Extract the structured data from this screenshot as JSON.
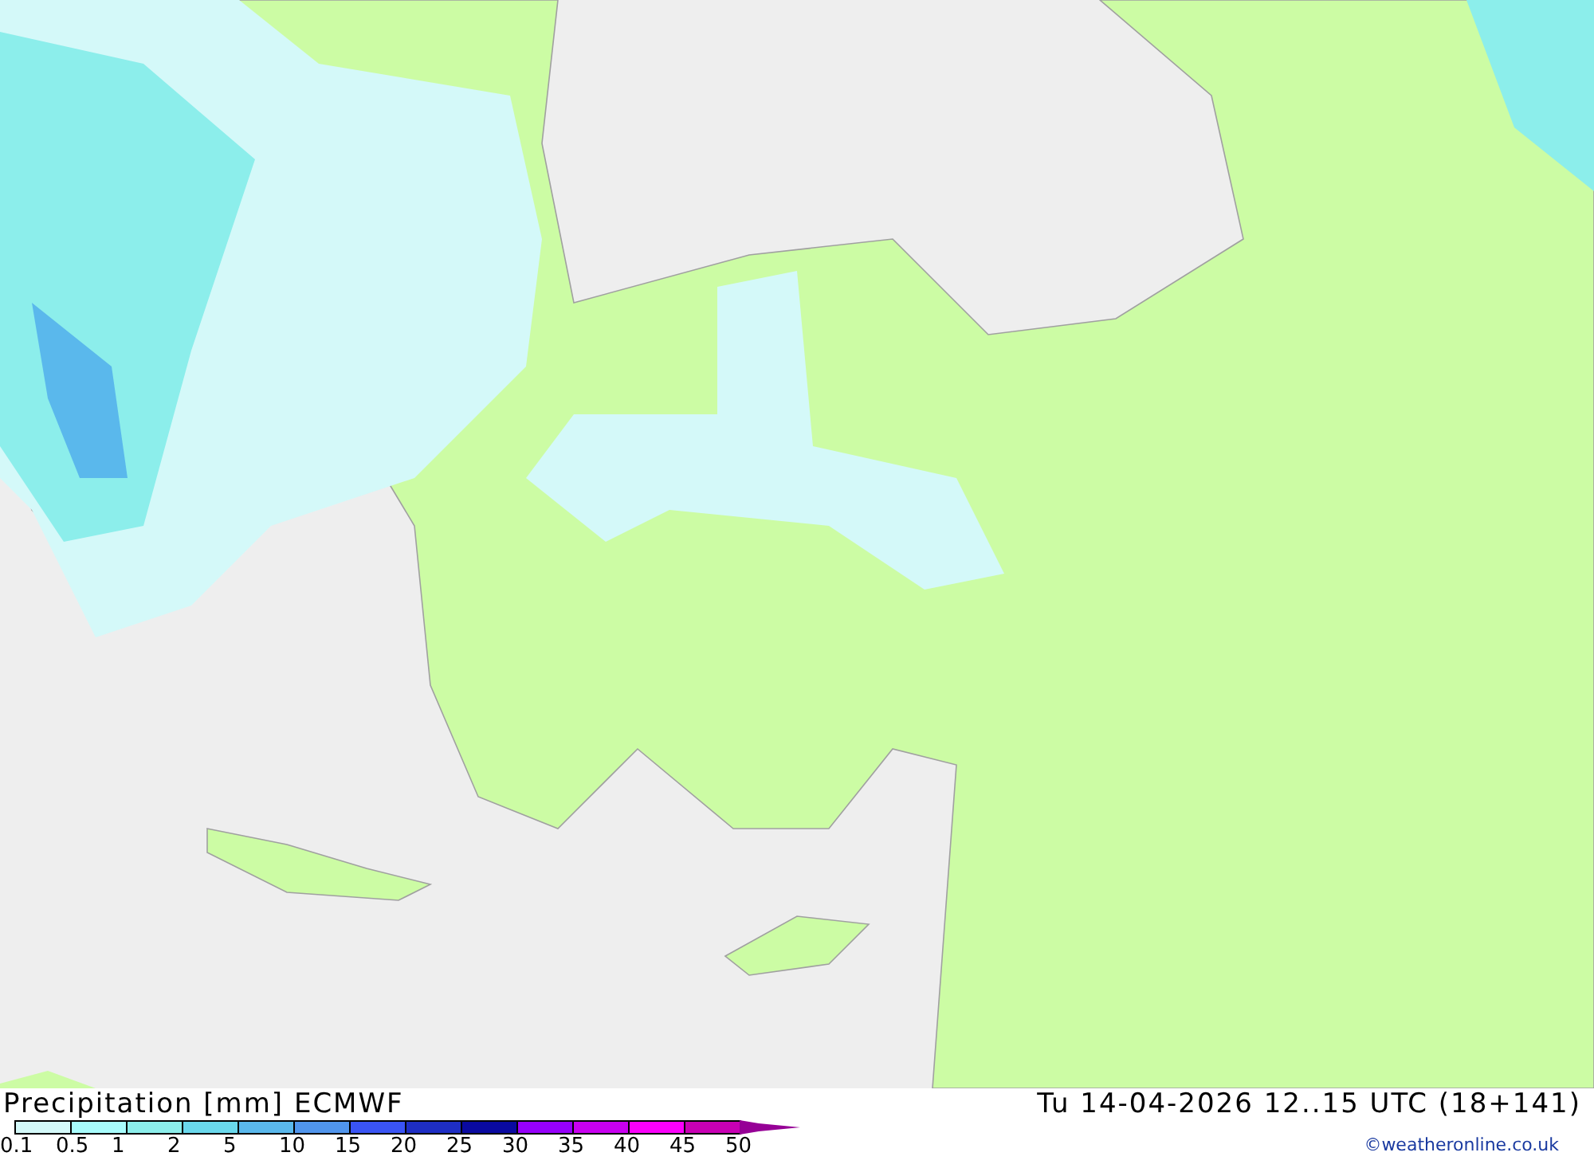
{
  "title": "Precipitation [mm] ECMWF",
  "valid_time": "Tu 14-04-2026 12..15 UTC (18+141)",
  "legend": {
    "bins": [
      {
        "color": "#d4f9f9"
      },
      {
        "color": "#a8fcfc"
      },
      {
        "color": "#8ceeeb"
      },
      {
        "color": "#6ad8ec"
      },
      {
        "color": "#5ab8ec"
      },
      {
        "color": "#5095ec"
      },
      {
        "color": "#3a54f4"
      },
      {
        "color": "#1e2ec4"
      },
      {
        "color": "#0a0aa0"
      },
      {
        "color": "#9600fa"
      },
      {
        "color": "#c800f0"
      },
      {
        "color": "#fa00fa"
      },
      {
        "color": "#c800b4"
      },
      {
        "color": "#960096",
        "kind": "arrow"
      }
    ],
    "ticks": [
      "0.1",
      "0.5",
      "1",
      "2",
      "5",
      "10",
      "15",
      "20",
      "25",
      "30",
      "35",
      "40",
      "45",
      "50"
    ]
  },
  "credit": "©weatheronline.co.uk"
}
